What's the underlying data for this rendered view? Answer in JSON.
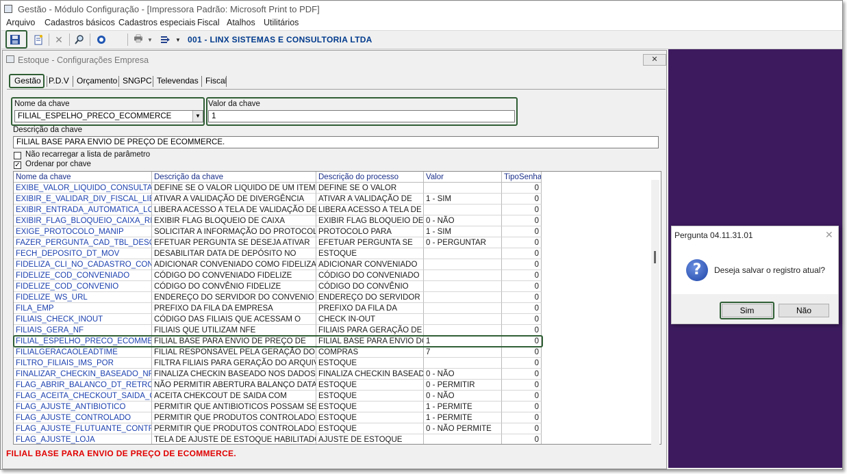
{
  "app": {
    "title": "Gestão  - Módulo Configuração - [Impressora Padrão: Microsoft Print to PDF]",
    "menu": [
      "Arquivo",
      "Cadastros básicos",
      "Cadastros especiais",
      "Fiscal",
      "Atalhos",
      "Utilitários"
    ],
    "company": "001 - LINX SISTEMAS E CONSULTORIA LTDA"
  },
  "toolbar": {
    "icons": [
      "save-icon",
      "new-document-icon",
      "delete-icon",
      "search-icon",
      "help-icon",
      "print-icon",
      "list-menu-icon"
    ]
  },
  "child_window": {
    "title": "Estoque - Configurações Empresa",
    "close_label": "✕",
    "tabs": [
      "Gestão",
      "P.D.V",
      "Orçamento",
      "SNGPC",
      "Televendas",
      "Fiscal"
    ],
    "key_name_label": "Nome da chave",
    "key_name_value": "FILIAL_ESPELHO_PRECO_ECOMMERCE",
    "key_value_label": "Valor da chave",
    "key_value_value": "1",
    "key_desc_label": "Descrição da chave",
    "key_desc_value": "FILIAL BASE PARA ENVIO DE PREÇO DE ECOMMERCE.",
    "checkbox_reload_label": "Não recarregar a lista de parâmetro",
    "checkbox_reload_checked": false,
    "checkbox_sort_label": "Ordenar por chave",
    "checkbox_sort_checked": true,
    "status_text": "FILIAL BASE PARA ENVIO DE PREÇO DE ECOMMERCE."
  },
  "grid": {
    "columns": [
      "Nome da chave",
      "Descrição  da chave",
      "Descrição do processo",
      "Valor",
      "TipoSenha"
    ],
    "rows": [
      [
        "EXIBE_VALOR_LIQUIDO_CONSULTA_PRE",
        "DEFINE SE O VALOR LIQUIDO DE UM ITEM",
        "DEFINE SE O VALOR",
        "",
        "0"
      ],
      [
        "EXIBIR_E_VALIDAR_DIV_FISCAL_LIBE",
        "ATIVAR A VALIDAÇÃO DE DIVERGÊNCIA",
        "ATIVAR A VALIDAÇÃO DE",
        "1 - SIM",
        "0"
      ],
      [
        "EXIBIR_ENTRADA_AUTOMATICA_LOJA",
        "LIBERA ACESSO A TELA DE VALIDAÇÃO DE",
        "LIBERA ACESSO A TELA DE",
        "",
        "0"
      ],
      [
        "EXIBIR_FLAG_BLOQUEIO_CAIXA_REAL",
        "EXIBIR FLAG BLOQUEIO DE CAIXA",
        "EXIBIR FLAG BLOQUEIO DE",
        "0 - NÃO",
        "0"
      ],
      [
        "EXIGE_PROTOCOLO_MANIP",
        "SOLICITAR A INFORMAÇÃO DO PROTOCOLO",
        "PROTOCOLO PARA",
        "1 - SIM",
        "0"
      ],
      [
        "FAZER_PERGUNTA_CAD_TBL_DESC",
        "EFETUAR PERGUNTA SE DESEJA ATIVAR",
        "EFETUAR PERGUNTA SE",
        "0 - PERGUNTAR",
        "0"
      ],
      [
        "FECH_DEPOSITO_DT_MOV",
        "DESABILITAR DATA DE DEPÓSITO NO",
        "ESTOQUE",
        "",
        "0"
      ],
      [
        "FIDELIZA_CLI_NO_CADASTRO_CONVE",
        "ADICIONAR CONVENIADO COMO FIDELIZADO",
        "ADICIONAR CONVENIADO",
        "",
        "0"
      ],
      [
        "FIDELIZE_COD_CONVENIADO",
        "CÓDIGO DO CONVENIADO FIDELIZE",
        "CÓDIGO DO CONVENIADO",
        "",
        "0"
      ],
      [
        "FIDELIZE_COD_CONVENIO",
        "CÓDIGO DO CONVÊNIO FIDELIZE",
        "CÓDIGO DO CONVÊNIO",
        "",
        "0"
      ],
      [
        "FIDELIZE_WS_URL",
        "ENDEREÇO DO SERVIDOR DO CONVENIO",
        "ENDEREÇO DO SERVIDOR",
        "",
        "0"
      ],
      [
        "FILA_EMP",
        "PREFIXO DA FILA DA EMPRESA",
        "PREFIXO DA FILA DA",
        "",
        "0"
      ],
      [
        "FILIAIS_CHECK_INOUT",
        "CÓDIGO DAS FILIAIS QUE ACESSAM O",
        "CHECK IN-OUT",
        "",
        "0"
      ],
      [
        "FILIAIS_GERA_NF",
        "FILIAIS QUE UTILIZAM NFE",
        "FILIAIS PARA GERAÇÃO DE",
        "",
        "0"
      ],
      [
        "FILIAL_ESPELHO_PRECO_ECOMMERCE",
        "FILIAL BASE PARA ENVIO DE PREÇO DE",
        "FILIAL BASE PARA ENVIO DO",
        "1",
        "0"
      ],
      [
        "FILIALGERACAOLEADTIME",
        "FILIAL RESPONSÁVEL PELA GERAÇÃO DO",
        "COMPRAS",
        "7",
        "0"
      ],
      [
        "FILTRO_FILIAIS_IMS_POR",
        "FILTRA FILIAIS PARA GERAÇÃO DO ARQUIVO",
        "ESTOQUE",
        "",
        "0"
      ],
      [
        "FINALIZAR_CHECKIN_BASEADO_NF_E",
        "FINALIZA CHECKIN BASEADO NOS DADOS",
        "FINALIZA CHECKIN BASEADO",
        "0 - NÃO",
        "0"
      ],
      [
        "FLAG_ABRIR_BALANCO_DT_RETROAT",
        "NÃO PERMITIR ABERTURA BALANÇO DATA",
        "ESTOQUE",
        "0 - PERMITIR",
        "0"
      ],
      [
        "FLAG_ACEITA_CHECKOUT_SAIDA_CO",
        "ACEITA CHEKCOUT DE SAIDA COM",
        "ESTOQUE",
        "0 - NÃO",
        "0"
      ],
      [
        "FLAG_AJUSTE_ANTIBIOTICO",
        "PERMITIR QUE ANTIBIOTICOS POSSAM SER",
        "ESTOQUE",
        "1 - PERMITE",
        "0"
      ],
      [
        "FLAG_AJUSTE_CONTROLADO",
        "PERMITIR QUE PRODUTOS CONTROLADOS",
        "ESTOQUE",
        "1 - PERMITE",
        "0"
      ],
      [
        "FLAG_AJUSTE_FLUTUANTE_CONTRO",
        "PERMITIR QUE PRODUTOS CONTROLADOS",
        "ESTOQUE",
        "0 - NÃO PERMITE",
        "0"
      ],
      [
        "FLAG_AJUSTE_LOJA",
        "TELA DE AJUSTE DE ESTOQUE HABILITADO",
        "AJUSTE DE ESTOQUE",
        "",
        "0"
      ]
    ],
    "selected_index": 14
  },
  "dialog": {
    "title": "Pergunta 04.11.31.01",
    "message": "Deseja salvar o registro atual?",
    "icon": "question-icon",
    "yes_label": "Sim",
    "no_label": "Não"
  },
  "colors": {
    "highlight": "#2f5e34",
    "status_red": "#e00000",
    "background_purple": "#3d1a5e",
    "link_blue": "#1a3fae"
  }
}
